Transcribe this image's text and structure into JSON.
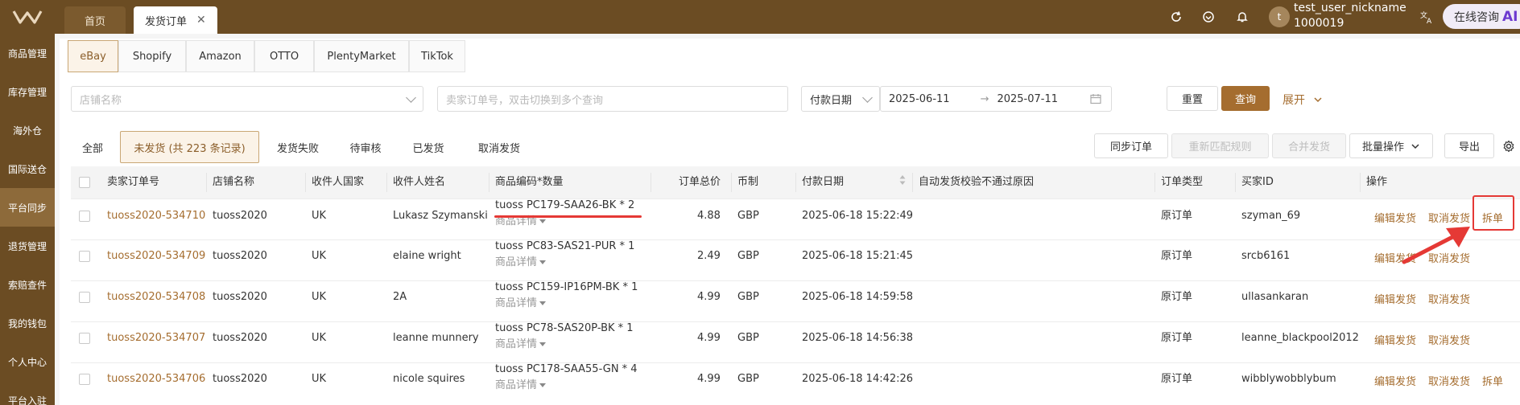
{
  "topbar": {
    "tabs": [
      {
        "label": "首页"
      },
      {
        "label": "发货订单"
      }
    ],
    "user": {
      "avatar_letter": "t",
      "name": "test_user_nickname",
      "id": "1000019"
    },
    "consult": {
      "label": "在线咨询",
      "badge": "AI"
    }
  },
  "sidebar": {
    "items": [
      {
        "label": "商品管理"
      },
      {
        "label": "库存管理"
      },
      {
        "label": "海外仓"
      },
      {
        "label": "国际送仓"
      },
      {
        "label": "平台同步"
      },
      {
        "label": "退货管理"
      },
      {
        "label": "索赔查件"
      },
      {
        "label": "我的钱包"
      },
      {
        "label": "个人中心"
      },
      {
        "label": "平台入驻"
      }
    ],
    "active": "平台同步"
  },
  "platform_tabs": [
    {
      "label": "eBay"
    },
    {
      "label": "Shopify"
    },
    {
      "label": "Amazon"
    },
    {
      "label": "OTTO"
    },
    {
      "label": "PlentyMarket"
    },
    {
      "label": "TikTok"
    }
  ],
  "filters": {
    "store_placeholder": "店铺名称",
    "order_placeholder": "卖家订单号，双击切换到多个查询",
    "date_type": "付款日期",
    "date_start": "2025-06-11",
    "date_sep": "→",
    "date_end": "2025-07-11",
    "reset": "重置",
    "search": "查询",
    "expand": "展开"
  },
  "status_tabs": [
    {
      "label": "全部"
    },
    {
      "label": "未发货 (共 223 条记录)"
    },
    {
      "label": "发货失败"
    },
    {
      "label": "待审核"
    },
    {
      "label": "已发货"
    },
    {
      "label": "取消发货"
    }
  ],
  "actions": {
    "sync": "同步订单",
    "rematch": "重新匹配规则",
    "merge": "合并发货",
    "batch": "批量操作",
    "export": "导出"
  },
  "table": {
    "headers": [
      "卖家订单号",
      "店铺名称",
      "收件人国家",
      "收件人姓名",
      "商品编码*数量",
      "订单总价",
      "币制",
      "付款日期",
      "自动发货校验不通过原因",
      "订单类型",
      "买家ID",
      "操作"
    ],
    "detail_label": "商品详情",
    "op_edit": "编辑发货",
    "op_cancel": "取消发货",
    "op_split": "拆单",
    "rows": [
      {
        "order": "tuoss2020-534710",
        "store": "tuoss2020",
        "country": "UK",
        "name": "Lukasz Szymanski",
        "sku": "tuoss PC179-SAA26-BK * 2",
        "total": "4.88",
        "currency": "GBP",
        "date": "2025-06-18 15:22:49",
        "type": "原订单",
        "buyer": "szyman_69",
        "split": true
      },
      {
        "order": "tuoss2020-534709",
        "store": "tuoss2020",
        "country": "UK",
        "name": "elaine wright",
        "sku": "tuoss PC83-SAS21-PUR * 1",
        "total": "2.49",
        "currency": "GBP",
        "date": "2025-06-18 15:21:45",
        "type": "原订单",
        "buyer": "srcb6161",
        "split": false
      },
      {
        "order": "tuoss2020-534708",
        "store": "tuoss2020",
        "country": "UK",
        "name": "2A",
        "sku": "tuoss PC159-IP16PM-BK * 1",
        "total": "4.99",
        "currency": "GBP",
        "date": "2025-06-18 14:59:58",
        "type": "原订单",
        "buyer": "ullasankaran",
        "split": false
      },
      {
        "order": "tuoss2020-534707",
        "store": "tuoss2020",
        "country": "UK",
        "name": "leanne munnery",
        "sku": "tuoss PC78-SAS20P-BK * 1",
        "total": "4.99",
        "currency": "GBP",
        "date": "2025-06-18 14:56:38",
        "type": "原订单",
        "buyer": "leanne_blackpool2012",
        "split": false
      },
      {
        "order": "tuoss2020-534706",
        "store": "tuoss2020",
        "country": "UK",
        "name": "nicole squires",
        "sku": "tuoss PC178-SAA55-GN * 4",
        "total": "4.99",
        "currency": "GBP",
        "date": "2025-06-18 14:42:26",
        "type": "原订单",
        "buyer": "wibblywobblybum",
        "split": true
      }
    ]
  },
  "colors": {
    "brand": "#6b4c23",
    "accent": "#a56d2f",
    "annotation": "#e53935"
  }
}
